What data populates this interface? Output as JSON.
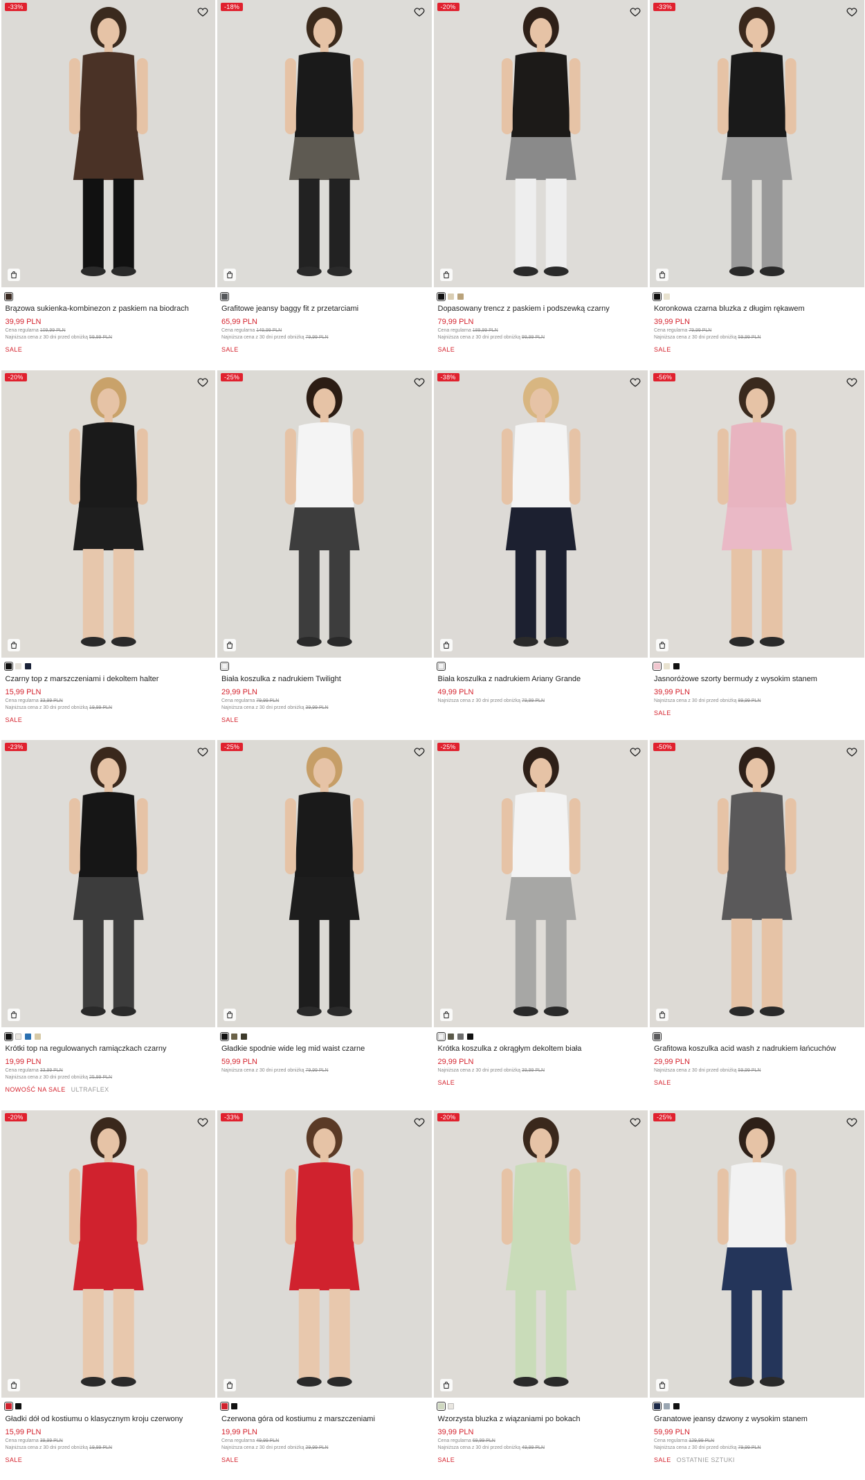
{
  "colors": {
    "sale_red": "#e0212e",
    "text": "#222222",
    "muted": "#888888"
  },
  "meta_labels": {
    "regular": "Cena regularna",
    "lowest": "Najniższa cena z 30 dni przed obniżką"
  },
  "products": [
    {
      "badge": "-33%",
      "name": "Brązowa sukienka-kombinezon z paskiem na biodrach",
      "price": "39,99 PLN",
      "regular": "109,99 PLN",
      "lowest": "59,99 PLN",
      "tags": [
        "SALE"
      ],
      "swatches": [
        "#3a2a22"
      ],
      "bg": "#dcdad6",
      "fig": {
        "top": "#4a3226",
        "bottom": "#4a3226",
        "legs": "#111111",
        "hair": "#3a2a1e"
      }
    },
    {
      "badge": "-18%",
      "name": "Grafitowe jeansy baggy fit z przetarciami",
      "price": "65,99 PLN",
      "regular": "149,99 PLN",
      "lowest": "79,99 PLN",
      "tags": [
        "SALE"
      ],
      "swatches": [
        "#55575a"
      ],
      "bg": "#dddcd8",
      "fig": {
        "top": "#1a1a1a",
        "bottom": "#5e5a52",
        "legs": "#222222",
        "hair": "#3b2a1c"
      }
    },
    {
      "badge": "-20%",
      "name": "Dopasowany trencz z paskiem i podszewką czarny",
      "price": "79,99 PLN",
      "regular": "189,99 PLN",
      "lowest": "99,99 PLN",
      "tags": [
        "SALE"
      ],
      "swatches": [
        "#111111",
        "#d9cdb3",
        "#b9a27a"
      ],
      "bg": "#dedcd8",
      "fig": {
        "top": "#1c1a18",
        "bottom": "#8a8a8a",
        "legs": "#eeeeee",
        "hair": "#2e2018"
      }
    },
    {
      "badge": "-33%",
      "name": "Koronkowa czarna bluzka z długim rękawem",
      "price": "39,99 PLN",
      "regular": "79,99 PLN",
      "lowest": "59,99 PLN",
      "tags": [
        "SALE"
      ],
      "swatches": [
        "#111111",
        "#e8e2cf"
      ],
      "bg": "#dcdbd7",
      "fig": {
        "top": "#1a1a1a",
        "bottom": "#9a9a9a",
        "legs": "#9a9a9a",
        "hair": "#3a281c"
      }
    },
    {
      "badge": "-20%",
      "name": "Czarny top z marszczeniami i dekoltem halter",
      "price": "15,99 PLN",
      "regular": "33,99 PLN",
      "lowest": "19,99 PLN",
      "tags": [
        "SALE"
      ],
      "swatches": [
        "#111111",
        "#e4e0d8",
        "#1a2238"
      ],
      "bg": "#dfdcd6",
      "fig": {
        "top": "#1a1a1a",
        "bottom": "#1e1e1e",
        "legs": "#e7c7ac",
        "hair": "#c9a26a"
      }
    },
    {
      "badge": "-25%",
      "name": "Biała koszulka z nadrukiem Twilight",
      "price": "29,99 PLN",
      "regular": "79,99 PLN",
      "lowest": "39,99 PLN",
      "tags": [
        "SALE"
      ],
      "swatches": [
        "#f2f2f2"
      ],
      "bg": "#dcdad5",
      "fig": {
        "top": "#f4f4f4",
        "bottom": "#3d3d3d",
        "legs": "#3d3d3d",
        "hair": "#2c1d14"
      }
    },
    {
      "badge": "-38%",
      "name": "Biała koszulka z nadrukiem Ariany Grande",
      "price": "49,99 PLN",
      "regular": "",
      "lowest": "79,99 PLN",
      "tags": [],
      "swatches": [
        "#f2f2f2"
      ],
      "bg": "#dddad6",
      "fig": {
        "top": "#f4f4f4",
        "bottom": "#1c2030",
        "legs": "#1c2030",
        "hair": "#d8b681"
      }
    },
    {
      "badge": "-56%",
      "name": "Jasnoróżowe szorty bermudy z wysokim stanem",
      "price": "39,99 PLN",
      "regular": "",
      "lowest": "89,99 PLN",
      "tags": [
        "SALE"
      ],
      "swatches": [
        "#f1c6cf",
        "#e8e2cf",
        "#111111"
      ],
      "bg": "#dfdcd7",
      "fig": {
        "top": "#e8b4c0",
        "bottom": "#eab9c6",
        "legs": "#e6c3a6",
        "hair": "#3a2a1e"
      }
    },
    {
      "badge": "-23%",
      "name": "Krótki top na regulowanych ramiączkach czarny",
      "price": "19,99 PLN",
      "regular": "33,99 PLN",
      "lowest": "25,99 PLN",
      "tags": [
        "NOWOŚĆ NA SALE",
        "ULTRAFLEX"
      ],
      "swatches": [
        "#111111",
        "#e9e6e0",
        "#2a6fb0",
        "#d6c9a6"
      ],
      "bg": "#dedcd8",
      "fig": {
        "top": "#161616",
        "bottom": "#3c3c3c",
        "legs": "#3c3c3c",
        "hair": "#3a281c"
      }
    },
    {
      "badge": "-25%",
      "name": "Gładkie spodnie wide leg mid waist czarne",
      "price": "59,99 PLN",
      "regular": "",
      "lowest": "79,99 PLN",
      "tags": [],
      "swatches": [
        "#111111",
        "#6b6248",
        "#3d3a2a"
      ],
      "bg": "#dcdad5",
      "fig": {
        "top": "#1a1a1a",
        "bottom": "#1d1d1d",
        "legs": "#1d1d1d",
        "hair": "#c69e67"
      }
    },
    {
      "badge": "-25%",
      "name": "Krótka koszulka z okrągłym dekoltem biała",
      "price": "29,99 PLN",
      "regular": "",
      "lowest": "39,99 PLN",
      "tags": [
        "SALE"
      ],
      "swatches": [
        "#f2f2f2",
        "#5b5a4a",
        "#6e6e6e",
        "#111111"
      ],
      "bg": "#dfdcd7",
      "fig": {
        "top": "#f3f3f3",
        "bottom": "#a7a7a5",
        "legs": "#a7a7a5",
        "hair": "#2e2018"
      }
    },
    {
      "badge": "-50%",
      "name": "Grafitowa koszulka acid wash z nadrukiem łańcuchów",
      "price": "29,99 PLN",
      "regular": "",
      "lowest": "59,99 PLN",
      "tags": [
        "SALE"
      ],
      "swatches": [
        "#5c5c5e"
      ],
      "bg": "#dddad5",
      "fig": {
        "top": "#5a595a",
        "bottom": "#5a595a",
        "legs": "#e6c3a6",
        "hair": "#2e2018"
      }
    },
    {
      "badge": "-20%",
      "name": "Gładki dół od kostiumu o klasycznym kroju czerwony",
      "price": "15,99 PLN",
      "regular": "39,99 PLN",
      "lowest": "19,99 PLN",
      "tags": [
        "SALE"
      ],
      "swatches": [
        "#d0222e",
        "#111111"
      ],
      "bg": "#dfdcd7",
      "fig": {
        "top": "#d0222e",
        "bottom": "#d0222e",
        "legs": "#e8c8ad",
        "hair": "#3a281c"
      }
    },
    {
      "badge": "-33%",
      "name": "Czerwona góra od kostiumu z marszczeniami",
      "price": "19,99 PLN",
      "regular": "49,99 PLN",
      "lowest": "29,99 PLN",
      "tags": [
        "SALE"
      ],
      "swatches": [
        "#d0222e",
        "#111111"
      ],
      "bg": "#dcdad6",
      "fig": {
        "top": "#d0222e",
        "bottom": "#d0222e",
        "legs": "#e8c8ad",
        "hair": "#5a3a26"
      }
    },
    {
      "badge": "-20%",
      "name": "Wzorzysta bluzka z wiązaniami po bokach",
      "price": "39,99 PLN",
      "regular": "69,99 PLN",
      "lowest": "49,99 PLN",
      "tags": [
        "SALE"
      ],
      "swatches": [
        "#cfd8c0",
        "#e9e6e0"
      ],
      "bg": "#dedbd6",
      "fig": {
        "top": "#c9dcb9",
        "bottom": "#c9dcb9",
        "legs": "#c9dcb9",
        "hair": "#3a281c"
      }
    },
    {
      "badge": "-25%",
      "name": "Granatowe jeansy dzwony z wysokim stanem",
      "price": "59,99 PLN",
      "regular": "129,99 PLN",
      "lowest": "79,99 PLN",
      "tags": [
        "SALE",
        "OSTATNIE SZTUKI"
      ],
      "swatches": [
        "#1c2a48",
        "#9aa6b2",
        "#111111"
      ],
      "bg": "#dddbd6",
      "fig": {
        "top": "#f2f2f2",
        "bottom": "#24355a",
        "legs": "#24355a",
        "hair": "#2e2018"
      }
    }
  ]
}
